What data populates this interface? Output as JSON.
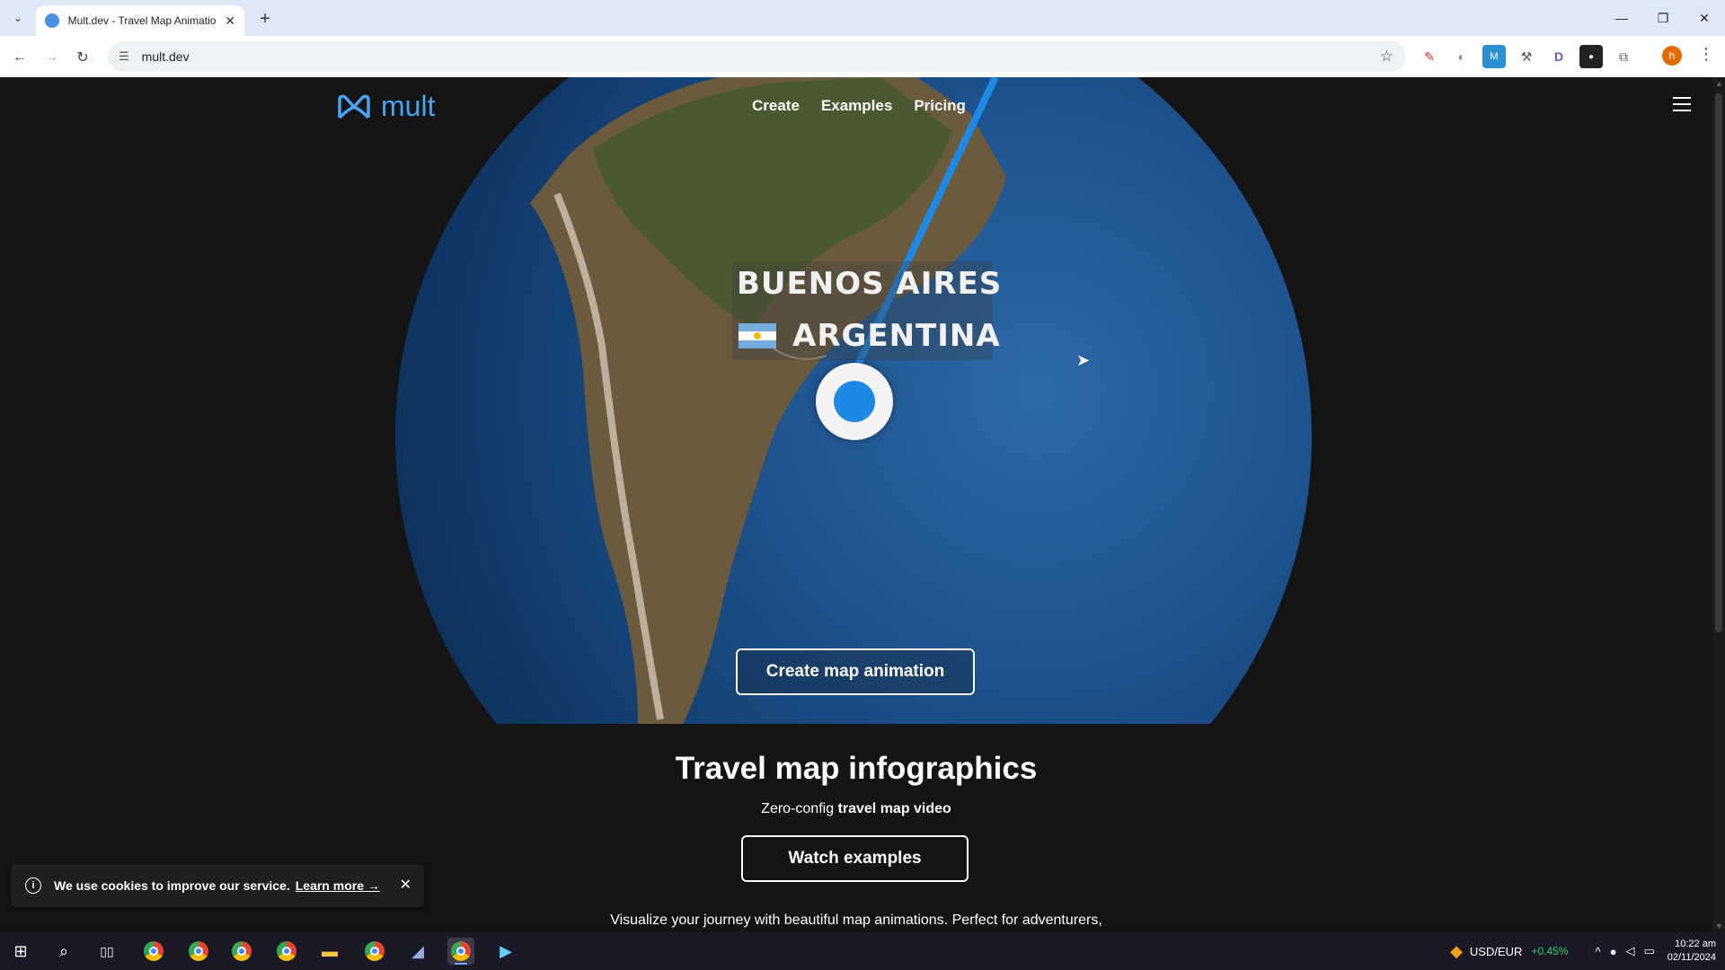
{
  "browser": {
    "tab_title": "Mult.dev - Travel Map Animatio",
    "url": "mult.dev",
    "new_tab": "+",
    "tab_close": "✕",
    "win_min": "—",
    "win_restore": "❐",
    "win_close": "✕",
    "profile_initial": "h"
  },
  "site": {
    "logo_text": "mult",
    "nav": [
      "Create",
      "Examples",
      "Pricing"
    ],
    "city": "BUENOS AIRES",
    "country": "ARGENTINA",
    "cta": "Create map animation",
    "section_title": "Travel map infographics",
    "section_sub_plain": "Zero-config ",
    "section_sub_bold": "travel map video",
    "watch_button": "Watch examples",
    "description": "Visualize your journey with beautiful map animations. Perfect for adventurers,"
  },
  "cookie": {
    "message": "We use cookies to improve our service.",
    "learn_more": "Learn more →",
    "close": "✕"
  },
  "taskbar": {
    "currency_pair": "USD/EUR",
    "currency_change": "+0.45%",
    "time": "10:22 am",
    "date": "02/11/2024"
  },
  "colors": {
    "brand": "#4aa3f0",
    "pin": "#1e88e5",
    "page_bg": "#141414",
    "positive": "#2ecc71"
  }
}
